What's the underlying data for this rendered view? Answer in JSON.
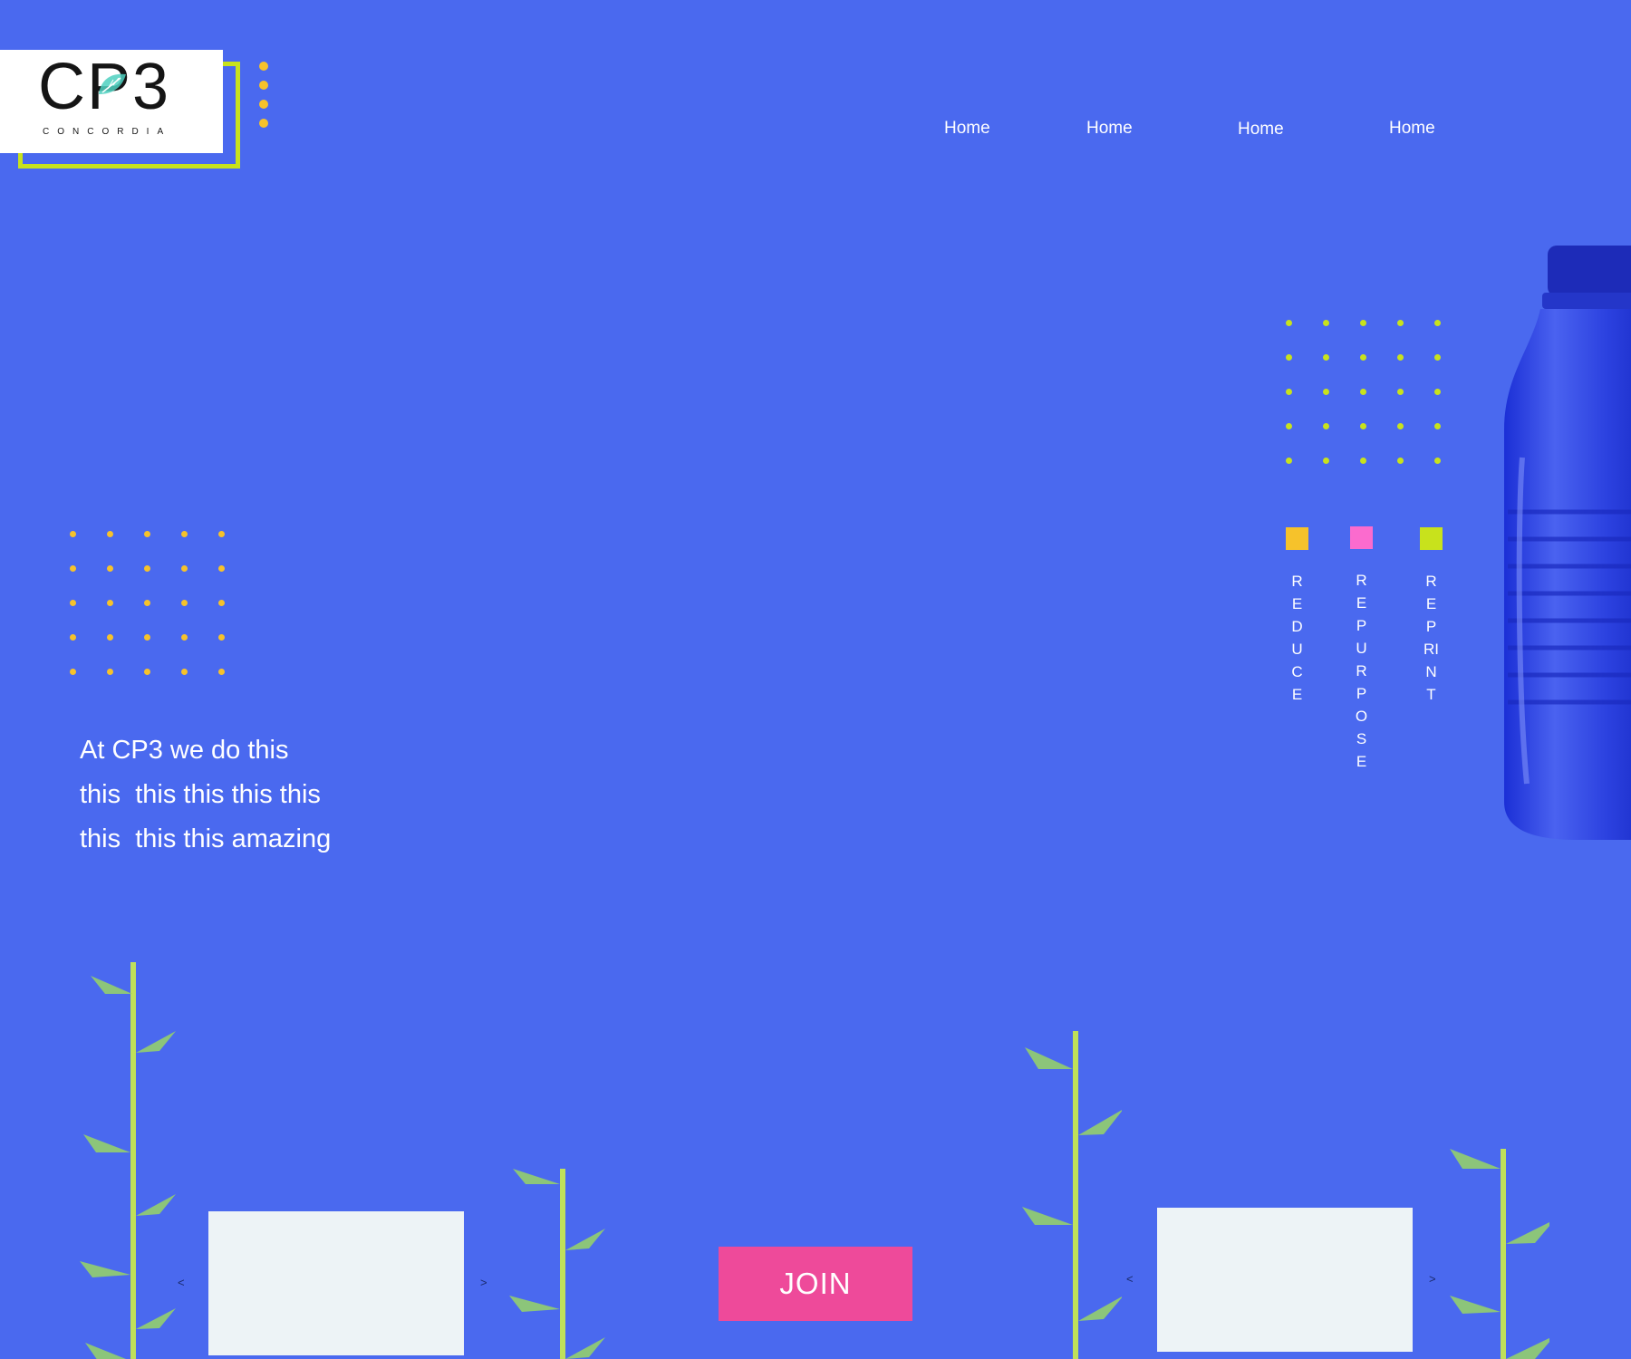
{
  "logo": {
    "text": "CP3",
    "subtext": "CONCORDIA"
  },
  "nav": {
    "items": [
      "Home",
      "Home",
      "Home",
      "Home"
    ]
  },
  "hero": {
    "tagline": "At CP3 we do this\nthis  this this this this\nthis  this this amazing"
  },
  "pillars": [
    {
      "word": "REDUCE",
      "color": "#f6c22b"
    },
    {
      "word": "REPURPOSE",
      "color": "#fb6bce"
    },
    {
      "word": "REPRINT",
      "color": "#c8e21c"
    }
  ],
  "carousels": [
    {
      "prev": "<",
      "next": ">"
    },
    {
      "prev": "<",
      "next": ">"
    }
  ],
  "cta": {
    "join_label": "JOIN"
  },
  "colors": {
    "background": "#4a69ef",
    "accent_yellow": "#f6c22b",
    "accent_lime": "#c8e21c",
    "accent_pink": "#ee4a9a",
    "leaf": "#8cc57a"
  },
  "icons": {
    "bottle": "water-bottle-image",
    "plant": "plant-sprout-icon",
    "leaf": "logo-leaf-icon"
  }
}
